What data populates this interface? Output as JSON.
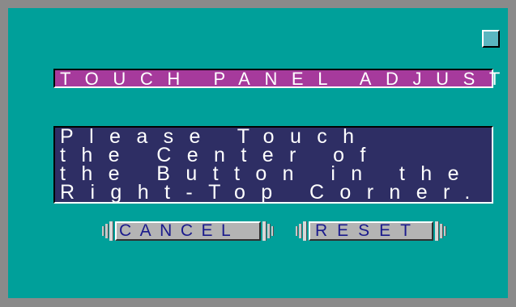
{
  "dialog": {
    "title": "TOUCH PANEL ADJUST",
    "message_lines": [
      "Please Touch",
      "the Center of",
      "the Button in the",
      "Right-Top Corner."
    ]
  },
  "buttons": {
    "cancel_label": "CANCEL",
    "reset_label": "RESET"
  },
  "colors": {
    "background": "#00a09a",
    "frame": "#8a8a8a",
    "title_bar": "#a63a9c",
    "message_box": "#2e2e64",
    "button_face": "#b4b4b4",
    "button_text": "#1a1a8c",
    "corner_target": "#5bb6c0"
  },
  "icons": {
    "calibration_target": "square-target-icon",
    "grip": "grip-bars-icon"
  }
}
